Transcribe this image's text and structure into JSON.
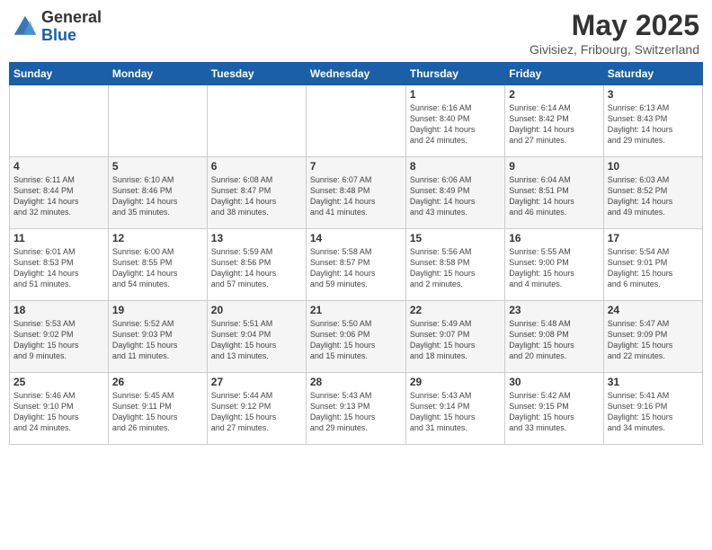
{
  "logo": {
    "general": "General",
    "blue": "Blue"
  },
  "title": "May 2025",
  "location": "Givisiez, Fribourg, Switzerland",
  "weekdays": [
    "Sunday",
    "Monday",
    "Tuesday",
    "Wednesday",
    "Thursday",
    "Friday",
    "Saturday"
  ],
  "weeks": [
    [
      {
        "day": "",
        "info": ""
      },
      {
        "day": "",
        "info": ""
      },
      {
        "day": "",
        "info": ""
      },
      {
        "day": "",
        "info": ""
      },
      {
        "day": "1",
        "info": "Sunrise: 6:16 AM\nSunset: 8:40 PM\nDaylight: 14 hours\nand 24 minutes."
      },
      {
        "day": "2",
        "info": "Sunrise: 6:14 AM\nSunset: 8:42 PM\nDaylight: 14 hours\nand 27 minutes."
      },
      {
        "day": "3",
        "info": "Sunrise: 6:13 AM\nSunset: 8:43 PM\nDaylight: 14 hours\nand 29 minutes."
      }
    ],
    [
      {
        "day": "4",
        "info": "Sunrise: 6:11 AM\nSunset: 8:44 PM\nDaylight: 14 hours\nand 32 minutes."
      },
      {
        "day": "5",
        "info": "Sunrise: 6:10 AM\nSunset: 8:46 PM\nDaylight: 14 hours\nand 35 minutes."
      },
      {
        "day": "6",
        "info": "Sunrise: 6:08 AM\nSunset: 8:47 PM\nDaylight: 14 hours\nand 38 minutes."
      },
      {
        "day": "7",
        "info": "Sunrise: 6:07 AM\nSunset: 8:48 PM\nDaylight: 14 hours\nand 41 minutes."
      },
      {
        "day": "8",
        "info": "Sunrise: 6:06 AM\nSunset: 8:49 PM\nDaylight: 14 hours\nand 43 minutes."
      },
      {
        "day": "9",
        "info": "Sunrise: 6:04 AM\nSunset: 8:51 PM\nDaylight: 14 hours\nand 46 minutes."
      },
      {
        "day": "10",
        "info": "Sunrise: 6:03 AM\nSunset: 8:52 PM\nDaylight: 14 hours\nand 49 minutes."
      }
    ],
    [
      {
        "day": "11",
        "info": "Sunrise: 6:01 AM\nSunset: 8:53 PM\nDaylight: 14 hours\nand 51 minutes."
      },
      {
        "day": "12",
        "info": "Sunrise: 6:00 AM\nSunset: 8:55 PM\nDaylight: 14 hours\nand 54 minutes."
      },
      {
        "day": "13",
        "info": "Sunrise: 5:59 AM\nSunset: 8:56 PM\nDaylight: 14 hours\nand 57 minutes."
      },
      {
        "day": "14",
        "info": "Sunrise: 5:58 AM\nSunset: 8:57 PM\nDaylight: 14 hours\nand 59 minutes."
      },
      {
        "day": "15",
        "info": "Sunrise: 5:56 AM\nSunset: 8:58 PM\nDaylight: 15 hours\nand 2 minutes."
      },
      {
        "day": "16",
        "info": "Sunrise: 5:55 AM\nSunset: 9:00 PM\nDaylight: 15 hours\nand 4 minutes."
      },
      {
        "day": "17",
        "info": "Sunrise: 5:54 AM\nSunset: 9:01 PM\nDaylight: 15 hours\nand 6 minutes."
      }
    ],
    [
      {
        "day": "18",
        "info": "Sunrise: 5:53 AM\nSunset: 9:02 PM\nDaylight: 15 hours\nand 9 minutes."
      },
      {
        "day": "19",
        "info": "Sunrise: 5:52 AM\nSunset: 9:03 PM\nDaylight: 15 hours\nand 11 minutes."
      },
      {
        "day": "20",
        "info": "Sunrise: 5:51 AM\nSunset: 9:04 PM\nDaylight: 15 hours\nand 13 minutes."
      },
      {
        "day": "21",
        "info": "Sunrise: 5:50 AM\nSunset: 9:06 PM\nDaylight: 15 hours\nand 15 minutes."
      },
      {
        "day": "22",
        "info": "Sunrise: 5:49 AM\nSunset: 9:07 PM\nDaylight: 15 hours\nand 18 minutes."
      },
      {
        "day": "23",
        "info": "Sunrise: 5:48 AM\nSunset: 9:08 PM\nDaylight: 15 hours\nand 20 minutes."
      },
      {
        "day": "24",
        "info": "Sunrise: 5:47 AM\nSunset: 9:09 PM\nDaylight: 15 hours\nand 22 minutes."
      }
    ],
    [
      {
        "day": "25",
        "info": "Sunrise: 5:46 AM\nSunset: 9:10 PM\nDaylight: 15 hours\nand 24 minutes."
      },
      {
        "day": "26",
        "info": "Sunrise: 5:45 AM\nSunset: 9:11 PM\nDaylight: 15 hours\nand 26 minutes."
      },
      {
        "day": "27",
        "info": "Sunrise: 5:44 AM\nSunset: 9:12 PM\nDaylight: 15 hours\nand 27 minutes."
      },
      {
        "day": "28",
        "info": "Sunrise: 5:43 AM\nSunset: 9:13 PM\nDaylight: 15 hours\nand 29 minutes."
      },
      {
        "day": "29",
        "info": "Sunrise: 5:43 AM\nSunset: 9:14 PM\nDaylight: 15 hours\nand 31 minutes."
      },
      {
        "day": "30",
        "info": "Sunrise: 5:42 AM\nSunset: 9:15 PM\nDaylight: 15 hours\nand 33 minutes."
      },
      {
        "day": "31",
        "info": "Sunrise: 5:41 AM\nSunset: 9:16 PM\nDaylight: 15 hours\nand 34 minutes."
      }
    ]
  ]
}
